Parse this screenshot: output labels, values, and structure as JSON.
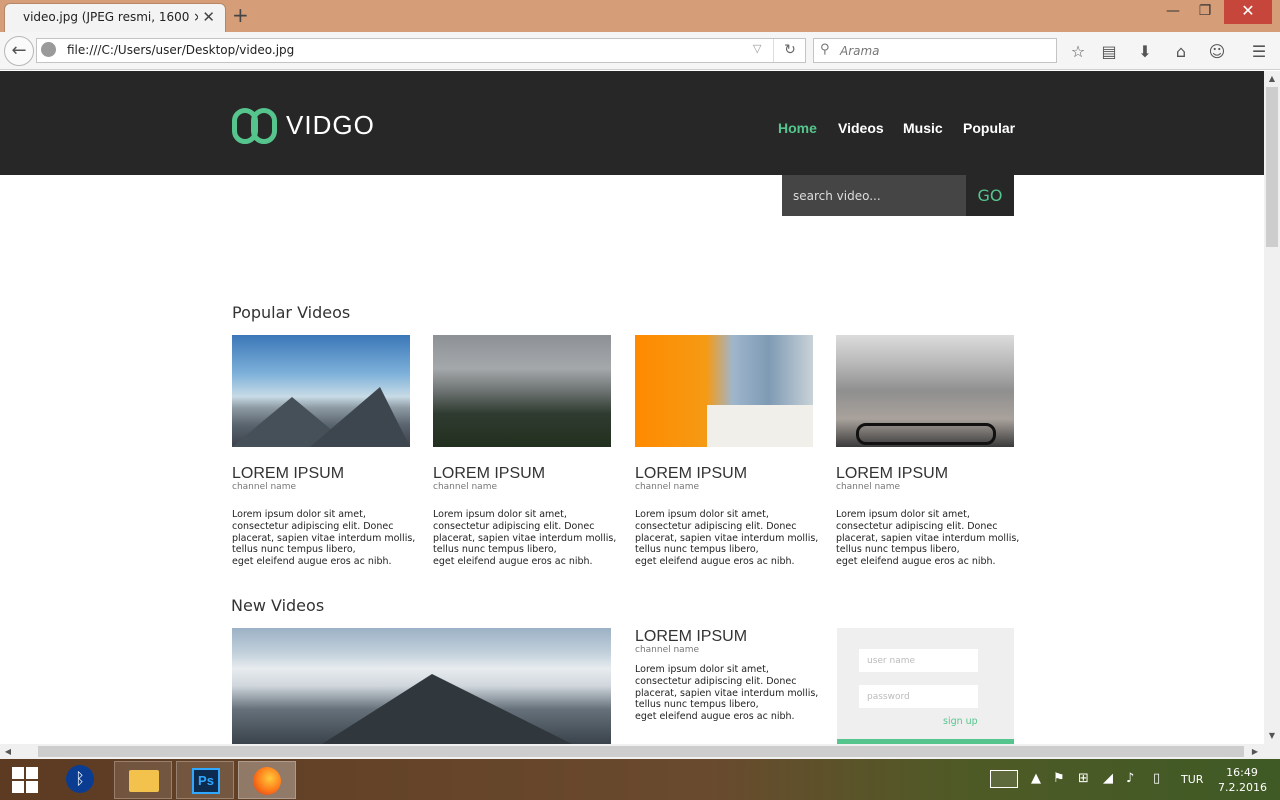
{
  "browser": {
    "tab_title": "video.jpg (JPEG resmi, 1600 × ...",
    "tab_close": "✕",
    "new_tab": "+",
    "url": "file:///C:/Users/user/Desktop/video.jpg",
    "search_placeholder": "Arama",
    "window_min": "—",
    "window_max": "❐",
    "window_close": "✕"
  },
  "site": {
    "logo_text": "VIDGO",
    "nav": [
      "Home",
      "Videos",
      "Music",
      "Popular"
    ],
    "active_nav": "Home",
    "search_placeholder": "search video...",
    "search_button": "GO",
    "accent_color": "#56c58d",
    "header_color": "#272727"
  },
  "popular": {
    "title": "Popular Videos",
    "cards": [
      {
        "title": "LOREM IPSUM",
        "channel": "channel name",
        "desc": [
          "Lorem ipsum dolor sit amet,",
          "consectetur adipiscing elit. Donec",
          "placerat, sapien vitae interdum mollis,",
          "tellus nunc tempus libero,",
          "eget eleifend augue eros ac nibh."
        ]
      },
      {
        "title": "LOREM IPSUM",
        "channel": "channel name",
        "desc": [
          "Lorem ipsum dolor sit amet,",
          "consectetur adipiscing elit. Donec",
          "placerat, sapien vitae interdum mollis,",
          "tellus nunc tempus libero,",
          "eget eleifend augue eros ac nibh."
        ]
      },
      {
        "title": "LOREM IPSUM",
        "channel": "channel name",
        "desc": [
          "Lorem ipsum dolor sit amet,",
          "consectetur adipiscing elit. Donec",
          "placerat, sapien vitae interdum mollis,",
          "tellus nunc tempus libero,",
          "eget eleifend augue eros ac nibh."
        ]
      },
      {
        "title": "LOREM IPSUM",
        "channel": "channel name",
        "desc": [
          "Lorem ipsum dolor sit amet,",
          "consectetur adipiscing elit. Donec",
          "placerat, sapien vitae interdum mollis,",
          "tellus nunc tempus libero,",
          "eget eleifend augue eros ac nibh."
        ]
      }
    ]
  },
  "new_videos": {
    "title": "New Videos",
    "feature": {
      "title": "LOREM IPSUM",
      "channel": "channel name",
      "desc": [
        "Lorem ipsum dolor sit amet,",
        "consectetur adipiscing elit. Donec",
        "placerat, sapien vitae interdum mollis,",
        "tellus nunc tempus libero,",
        "eget eleifend augue eros ac nibh."
      ]
    }
  },
  "login": {
    "username_placeholder": "user name",
    "password_placeholder": "password",
    "signup": "sign up"
  },
  "taskbar": {
    "language": "TUR",
    "time": "16:49",
    "date": "7.2.2016"
  }
}
